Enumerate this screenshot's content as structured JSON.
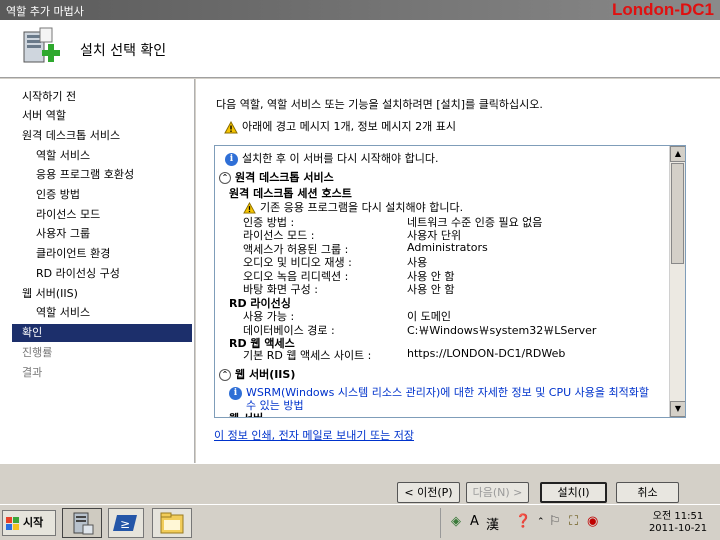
{
  "window": {
    "title": "역할 추가 마법사",
    "hostname": "London-DC1"
  },
  "header": {
    "title": "설치 선택 확인",
    "icon": "server-add-role-icon"
  },
  "sidebar": {
    "items": [
      {
        "label": "시작하기 전"
      },
      {
        "label": "서버 역할"
      },
      {
        "label": "원격 데스크톱 서비스"
      },
      {
        "label": "역할 서비스"
      },
      {
        "label": "응용 프로그램 호환성"
      },
      {
        "label": "인증 방법"
      },
      {
        "label": "라이선스 모드"
      },
      {
        "label": "사용자 그룹"
      },
      {
        "label": "클라이언트 환경"
      },
      {
        "label": "RD 라이선싱 구성"
      },
      {
        "label": "웹 서버(IIS)"
      },
      {
        "label": "역할 서비스"
      },
      {
        "label": "확인"
      },
      {
        "label": "진행률"
      },
      {
        "label": "결과"
      }
    ]
  },
  "main": {
    "intro": "다음 역할, 역할 서비스 또는 기능을 설치하려면 [설치]를 클릭하십시오.",
    "warning_summary": "아래에 경고 메시지 1개, 정보 메시지 2개 표시",
    "restart_notice": "설치한 후 이 서버를 다시 시작해야 합니다.",
    "rds_section": "원격 데스크톱 서비스",
    "rdsh_heading": "원격 데스크톱 세션 호스트",
    "rdsh_warning": "기존 응용 프로그램을 다시 설치해야 합니다.",
    "rdsh_rows": [
      {
        "label": "인증 방법 :",
        "value": "네트워크 수준 인증 필요 없음"
      },
      {
        "label": "라이선스 모드 :",
        "value": "사용자 단위"
      },
      {
        "label": "액세스가 허용된 그룹 :",
        "value": "Administrators"
      },
      {
        "label": "오디오 및 비디오 재생 :",
        "value": "사용"
      },
      {
        "label": "오디오 녹음 리디렉션 :",
        "value": "사용 안 함"
      },
      {
        "label": "바탕 화면 구성 :",
        "value": "사용 안 함"
      }
    ],
    "rdl_heading": "RD 라이선싱",
    "rdl_rows": [
      {
        "label": "사용 가능 :",
        "value": "이 도메인"
      },
      {
        "label": "데이터베이스 경로 :",
        "value": "C:￦Windows￦system32￦LServer"
      }
    ],
    "rdweb_heading": "RD 웹 액세스",
    "rdweb_rows": [
      {
        "label": "기본 RD 웹 액세스 사이트 :",
        "value": "https://LONDON-DC1/RDWeb"
      }
    ],
    "iis_section": "웹 서버(IIS)",
    "iis_info_line1": "WSRM(Windows 시스템 리소스 관리자)에 대한 자세한 정보 및 CPU 사용을 최적화할",
    "iis_info_line2": "수 있는 방법",
    "iis_partial": "웹 서버",
    "print_link": "이 정보 인쇄, 전자 메일로 보내기 또는 저장"
  },
  "buttons": {
    "prev": "< 이전(P)",
    "next": "다음(N) >",
    "install": "설치(I)",
    "cancel": "취소"
  },
  "taskbar": {
    "start": "시작",
    "ime_a": "A",
    "ime_han": "漢",
    "time": "오전 11:51",
    "date": "2011-10-21"
  }
}
